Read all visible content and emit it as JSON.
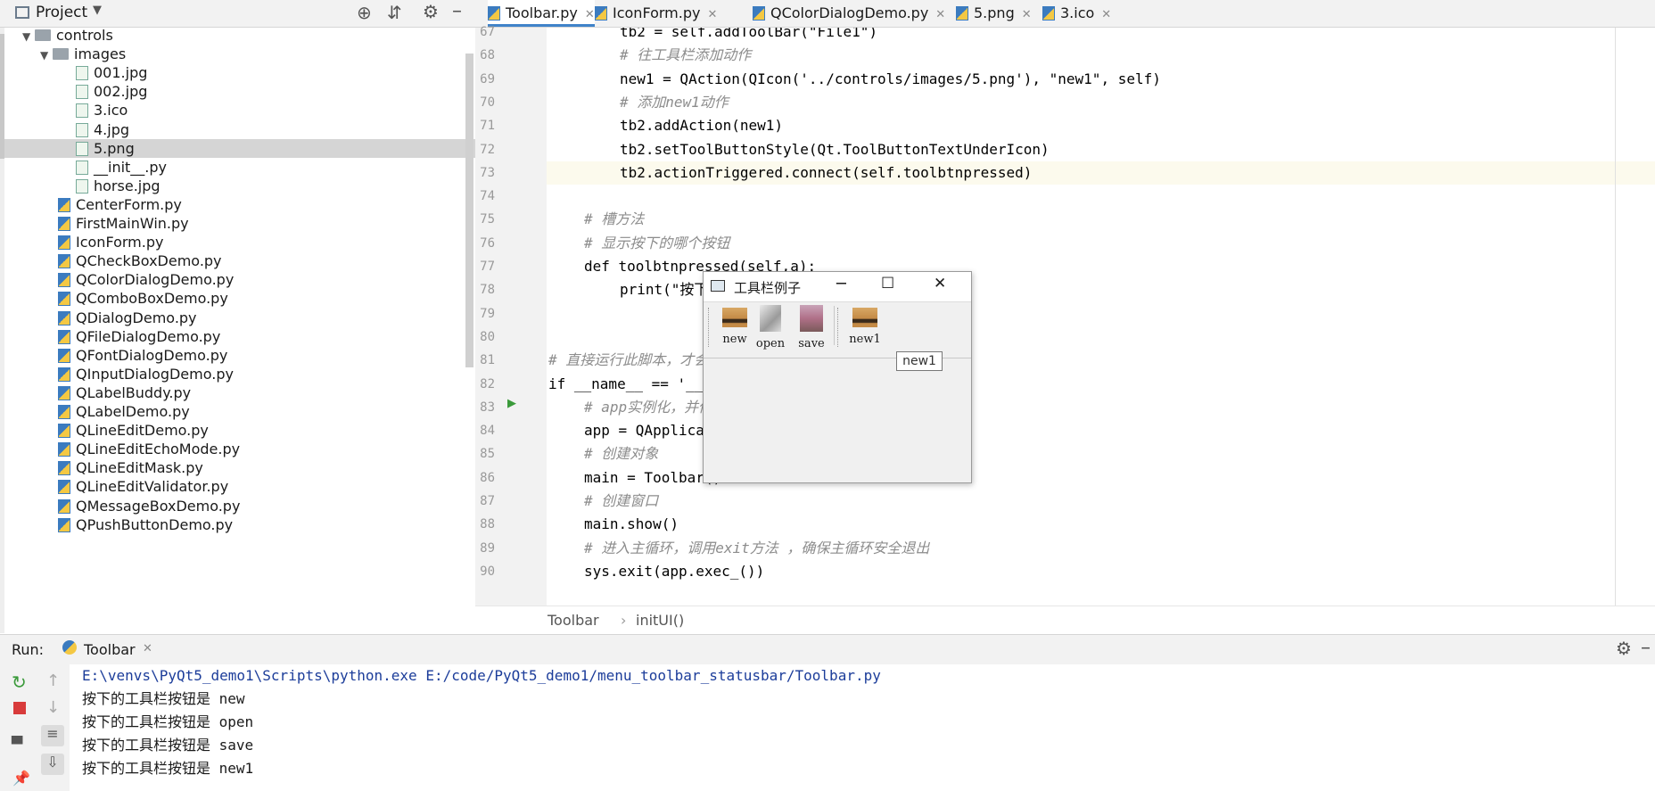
{
  "project_panel": {
    "title": "Project",
    "tree": [
      {
        "label": "controls",
        "kind": "folder"
      },
      {
        "label": "images",
        "kind": "folder"
      },
      {
        "label": "001.jpg",
        "kind": "file"
      },
      {
        "label": "002.jpg",
        "kind": "file"
      },
      {
        "label": "3.ico",
        "kind": "file"
      },
      {
        "label": "4.jpg",
        "kind": "file"
      },
      {
        "label": "5.png",
        "kind": "file",
        "selected": true
      },
      {
        "label": "__init__.py",
        "kind": "file"
      },
      {
        "label": "horse.jpg",
        "kind": "file"
      },
      {
        "label": "CenterForm.py",
        "kind": "py"
      },
      {
        "label": "FirstMainWin.py",
        "kind": "py"
      },
      {
        "label": "IconForm.py",
        "kind": "py"
      },
      {
        "label": "QCheckBoxDemo.py",
        "kind": "py"
      },
      {
        "label": "QColorDialogDemo.py",
        "kind": "py"
      },
      {
        "label": "QComboBoxDemo.py",
        "kind": "py"
      },
      {
        "label": "QDialogDemo.py",
        "kind": "py"
      },
      {
        "label": "QFileDialogDemo.py",
        "kind": "py"
      },
      {
        "label": "QFontDialogDemo.py",
        "kind": "py"
      },
      {
        "label": "QInputDialogDemo.py",
        "kind": "py"
      },
      {
        "label": "QLabelBuddy.py",
        "kind": "py"
      },
      {
        "label": "QLabelDemo.py",
        "kind": "py"
      },
      {
        "label": "QLineEditDemo.py",
        "kind": "py"
      },
      {
        "label": "QLineEditEchoMode.py",
        "kind": "py"
      },
      {
        "label": "QLineEditMask.py",
        "kind": "py"
      },
      {
        "label": "QLineEditValidator.py",
        "kind": "py"
      },
      {
        "label": "QMessageBoxDemo.py",
        "kind": "py"
      },
      {
        "label": "QPushButtonDemo.py",
        "kind": "py"
      }
    ]
  },
  "tabs": [
    {
      "label": "Toolbar.py",
      "active": true
    },
    {
      "label": "IconForm.py"
    },
    {
      "label": "QColorDialogDemo.py"
    },
    {
      "label": "5.png"
    },
    {
      "label": "3.ico"
    }
  ],
  "editor": {
    "lines": [
      {
        "n": "67",
        "text": "tb2 = self.addToolBar(\"File1\")"
      },
      {
        "n": "68",
        "text": "# 往工具栏添加动作"
      },
      {
        "n": "69",
        "text": "new1 = QAction(QIcon('../controls/images/5.png'), \"new1\", self)"
      },
      {
        "n": "70",
        "text": "# 添加new1动作"
      },
      {
        "n": "71",
        "text": "tb2.addAction(new1)"
      },
      {
        "n": "72",
        "text": "tb2.setToolButtonStyle(Qt.ToolButtonTextUnderIcon)"
      },
      {
        "n": "73",
        "text": "tb2.actionTriggered.connect(self.toolbtnpressed)"
      },
      {
        "n": "74",
        "text": ""
      },
      {
        "n": "75",
        "text": "# 槽方法"
      },
      {
        "n": "76",
        "text": "# 显示按下的哪个按钮"
      },
      {
        "n": "77",
        "text": "def toolbtnpressed(self,a):"
      },
      {
        "n": "78",
        "text": "print(\"按下"
      },
      {
        "n": "79",
        "text": ""
      },
      {
        "n": "80",
        "text": ""
      },
      {
        "n": "81",
        "text": "# 直接运行此脚本，才会"
      },
      {
        "n": "82",
        "text": "if __name__ == '__"
      },
      {
        "n": "83",
        "text": "# app实例化，并传"
      },
      {
        "n": "84",
        "text": "app = QApplica"
      },
      {
        "n": "85",
        "text": "# 创建对象"
      },
      {
        "n": "86",
        "text": "main = Toolbar()"
      },
      {
        "n": "87",
        "text": "# 创建窗口"
      },
      {
        "n": "88",
        "text": "main.show()"
      },
      {
        "n": "89",
        "text": "# 进入主循环，调用exit方法 ，确保主循环安全退出"
      },
      {
        "n": "90",
        "text": "sys.exit(app.exec_())"
      }
    ]
  },
  "breadcrumbs": {
    "class_name": "Toolbar",
    "separator": "›",
    "method": "initUI()"
  },
  "run_panel": {
    "label": "Run:",
    "tab_label": "Toolbar",
    "console_lines": [
      "E:\\venvs\\PyQt5_demo1\\Scripts\\python.exe E:/code/PyQt5_demo1/menu_toolbar_statusbar/Toolbar.py",
      "按下的工具栏按钮是 new",
      "按下的工具栏按钮是 open",
      "按下的工具栏按钮是 save",
      "按下的工具栏按钮是 new1"
    ]
  },
  "window": {
    "title": "工具栏例子",
    "buttons": [
      {
        "label": "new"
      },
      {
        "label": "open"
      },
      {
        "label": "save"
      },
      {
        "label": "new1"
      }
    ],
    "tooltip": "new1"
  },
  "colors": {
    "accent": "#4083c9",
    "selected_row": "#d5d5d5",
    "current_line": "#fcfaed"
  }
}
